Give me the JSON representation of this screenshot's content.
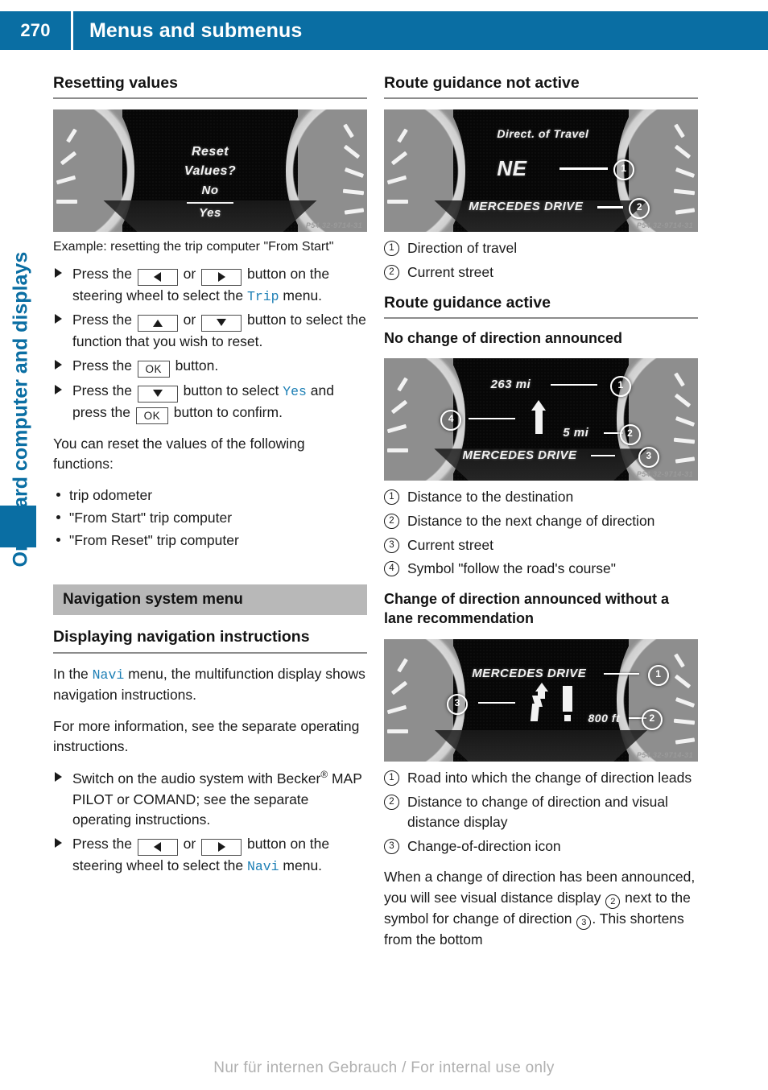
{
  "header": {
    "page_number": "270",
    "title": "Menus and submenus"
  },
  "side_tab": {
    "label": "On-board computer and displays",
    "accent_color": "#0a6ea3"
  },
  "left_column": {
    "heading": "Resetting values",
    "figure": {
      "name": "reset-values-cluster",
      "screen_lines": [
        "Reset",
        "Values?",
        "No",
        "Yes"
      ],
      "code": "P54.32-9714-31"
    },
    "caption": "Example: resetting the trip computer \"From Start\"",
    "steps": [
      {
        "parts": [
          {
            "type": "text",
            "value": "Press the "
          },
          {
            "type": "key",
            "value": "left-arrow"
          },
          {
            "type": "text",
            "value": " or "
          },
          {
            "type": "key",
            "value": "right-arrow"
          },
          {
            "type": "text",
            "value": " button on the steering wheel to select the "
          },
          {
            "type": "mono",
            "value": "Trip"
          },
          {
            "type": "text",
            "value": " menu."
          }
        ]
      },
      {
        "parts": [
          {
            "type": "text",
            "value": "Press the "
          },
          {
            "type": "key",
            "value": "up-arrow"
          },
          {
            "type": "text",
            "value": " or "
          },
          {
            "type": "key",
            "value": "down-arrow"
          },
          {
            "type": "text",
            "value": " button to select the function that you wish to reset."
          }
        ]
      },
      {
        "parts": [
          {
            "type": "text",
            "value": "Press the "
          },
          {
            "type": "key",
            "value": "OK"
          },
          {
            "type": "text",
            "value": " button."
          }
        ]
      },
      {
        "parts": [
          {
            "type": "text",
            "value": "Press the "
          },
          {
            "type": "key",
            "value": "down-arrow"
          },
          {
            "type": "text",
            "value": " button to select "
          },
          {
            "type": "mono",
            "value": "Yes"
          },
          {
            "type": "text",
            "value": " and press the "
          },
          {
            "type": "key",
            "value": "OK"
          },
          {
            "type": "text",
            "value": " button to confirm."
          }
        ]
      }
    ],
    "reset_intro": "You can reset the values of the following functions:",
    "reset_items": [
      "trip odometer",
      "\"From Start\" trip computer",
      "\"From Reset\" trip computer"
    ],
    "section_band": "Navigation system menu",
    "nav_heading": "Displaying navigation instructions",
    "nav_para_1_a": "In the ",
    "nav_para_1_mono": "Navi",
    "nav_para_1_b": " menu, the multifunction display shows navigation instructions.",
    "nav_para_2": "For more information, see the separate operating instructions.",
    "nav_step_1_a": "Switch on the audio system with Becker",
    "nav_step_1_sup": "®",
    "nav_step_1_b": " MAP PILOT or COMAND; see the separate operating instructions.",
    "nav_step_2_a": "Press the ",
    "nav_step_2_b": " or ",
    "nav_step_2_c": " button on the steering wheel to select the ",
    "nav_step_2_mono": "Navi",
    "nav_step_2_d": " menu."
  },
  "right_column": {
    "heading_not_active": "Route guidance not active",
    "figure_not_active": {
      "name": "route-guidance-not-active-cluster",
      "label_top": "Direct. of Travel",
      "direction": "NE",
      "street": "MERCEDES DRIVE",
      "callouts": [
        "1",
        "2"
      ],
      "code": "P54.32-9714-31"
    },
    "legend_not_active": [
      {
        "num": "1",
        "text": "Direction of travel"
      },
      {
        "num": "2",
        "text": "Current street"
      }
    ],
    "heading_active": "Route guidance active",
    "sub_no_change": "No change of direction announced",
    "figure_no_change": {
      "name": "no-change-of-direction-cluster",
      "distance_destination": "263 mi",
      "distance_next": "5 mi",
      "street": "MERCEDES DRIVE",
      "callouts": [
        "1",
        "2",
        "3",
        "4"
      ],
      "code": "P54.32-9714-31"
    },
    "legend_no_change": [
      {
        "num": "1",
        "text": "Distance to the destination"
      },
      {
        "num": "2",
        "text": "Distance to the next change of direction"
      },
      {
        "num": "3",
        "text": "Current street"
      },
      {
        "num": "4",
        "text": "Symbol \"follow the road's course\""
      }
    ],
    "sub_change": "Change of direction announced without a lane recommendation",
    "figure_change": {
      "name": "change-of-direction-cluster",
      "street": "MERCEDES DRIVE",
      "distance": "800 ft",
      "callouts": [
        "1",
        "2",
        "3"
      ],
      "code": "P54.32-9714-31"
    },
    "legend_change": [
      {
        "num": "1",
        "text": "Road into which the change of direction leads"
      },
      {
        "num": "2",
        "text": "Distance to change of direction and visual distance display"
      },
      {
        "num": "3",
        "text": "Change-of-direction icon"
      }
    ],
    "closing_a": "When a change of direction has been announced, you will see visual distance display ",
    "closing_num_1": "2",
    "closing_b": " next to the symbol for change of direction ",
    "closing_num_2": "3",
    "closing_c": ". This shortens from the bottom"
  },
  "footer": {
    "text": "Nur für internen Gebrauch / For internal use only"
  }
}
